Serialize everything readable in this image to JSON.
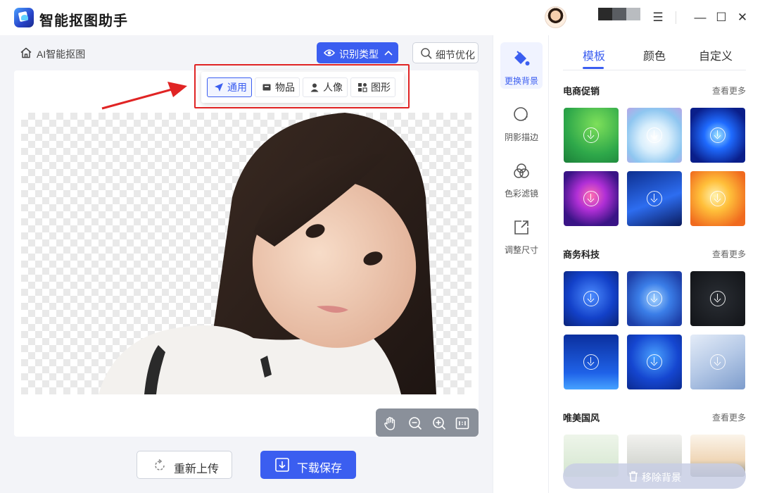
{
  "app": {
    "title": "智能抠图助手"
  },
  "window": {
    "controls": [
      "☰",
      "—",
      "☐",
      "✕"
    ]
  },
  "breadcrumb": {
    "label": "AI智能抠图"
  },
  "toolbar": {
    "identify_label": "识别类型",
    "detail_label": "细节优化",
    "type_options": [
      {
        "label": "通用",
        "icon": "cursor-arrow-icon",
        "active": true
      },
      {
        "label": "物品",
        "icon": "box-icon",
        "active": false
      },
      {
        "label": "人像",
        "icon": "person-icon",
        "active": false
      },
      {
        "label": "图形",
        "icon": "shapes-icon",
        "active": false
      }
    ]
  },
  "bottom": {
    "reupload_label": "重新上传",
    "save_label": "下载保存"
  },
  "tools": [
    {
      "label": "更换背景",
      "icon": "paint-bucket-icon",
      "active": true
    },
    {
      "label": "阴影描边",
      "icon": "shadow-circle-icon",
      "active": false
    },
    {
      "label": "色彩滤镜",
      "icon": "color-filter-icon",
      "active": false
    },
    {
      "label": "调整尺寸",
      "icon": "resize-icon",
      "active": false
    }
  ],
  "right": {
    "tabs": [
      {
        "label": "模板",
        "active": true
      },
      {
        "label": "颜色",
        "active": false
      },
      {
        "label": "自定义",
        "active": false
      }
    ],
    "more_label": "查看更多",
    "sections": [
      {
        "title": "电商促销"
      },
      {
        "title": "商务科技"
      },
      {
        "title": "唯美国风"
      }
    ],
    "remove_bg_label": "移除背景"
  },
  "colors": {
    "accent": "#3b5ef0",
    "highlight": "#e02424"
  }
}
